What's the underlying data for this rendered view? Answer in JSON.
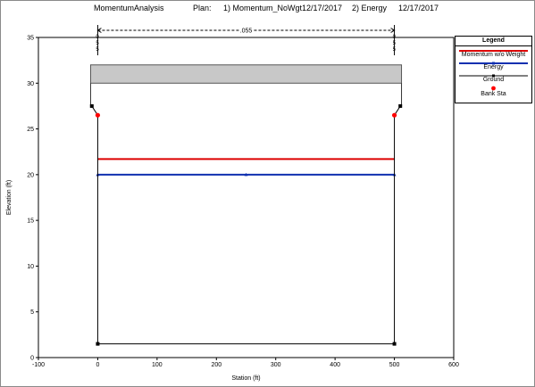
{
  "header": {
    "project": "MomentumAnalysis",
    "plan_label": "Plan:",
    "plan1": "1) Momentum_NoWgt",
    "date1": "12/17/2017",
    "plan2": "2) Energy",
    "date2": "12/17/2017"
  },
  "legend": {
    "title": "Legend",
    "items": [
      {
        "label": "Momentum w/o Weight",
        "color": "#dd0000",
        "kind": "line"
      },
      {
        "label": "Energy",
        "color": "#1030b0",
        "kind": "line-marker"
      },
      {
        "label": "Ground",
        "color": "#000000",
        "kind": "line-marker"
      },
      {
        "label": "Bank Sta",
        "color": "#ff0000",
        "kind": "point"
      }
    ]
  },
  "chart_data": {
    "type": "line",
    "xlabel": "Station (ft)",
    "ylabel": "Elevation (ft)",
    "xlim": [
      -100,
      600
    ],
    "ylim": [
      0,
      35
    ],
    "xticks": [
      -100,
      0,
      100,
      200,
      300,
      400,
      500,
      600
    ],
    "yticks": [
      0,
      5,
      10,
      15,
      20,
      25,
      30,
      35
    ],
    "grid": false,
    "legend_position": "right",
    "manning_label": ".055",
    "manning_range": [
      0,
      500
    ],
    "station_marks": [
      "0",
      "5",
      "5"
    ],
    "series": [
      {
        "name": "Momentum w/o Weight",
        "color": "#dd0000",
        "x": [
          0,
          500
        ],
        "y": [
          21.7,
          21.7
        ]
      },
      {
        "name": "Energy",
        "color": "#1030b0",
        "x": [
          0,
          250,
          500
        ],
        "y": [
          20.0,
          20.0,
          20.0
        ]
      },
      {
        "name": "Ground",
        "color": "#000000",
        "x": [
          -10,
          0,
          0,
          500,
          500,
          510
        ],
        "y": [
          27.5,
          26.5,
          1.5,
          1.5,
          26.5,
          27.5
        ]
      },
      {
        "name": "Bank Sta",
        "color": "#ff0000",
        "x": [
          0,
          500
        ],
        "y": [
          26.5,
          26.5
        ]
      }
    ],
    "deck": {
      "x": [
        -12,
        512
      ],
      "low_chord": 30,
      "high_chord": 32,
      "fill": "#c8c8c8"
    }
  }
}
